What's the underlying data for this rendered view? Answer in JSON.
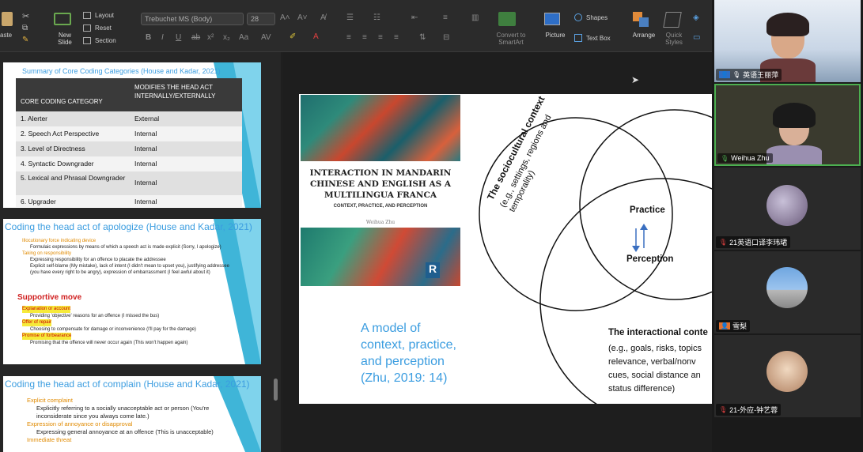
{
  "ribbon": {
    "paste": "aste",
    "layout": "Layout",
    "reset": "Reset",
    "section": "Section",
    "new_slide": "New\nSlide",
    "font_name": "Trebuchet MS (Body)",
    "font_size": "28",
    "convert": "Convert to\nSmartArt",
    "picture": "Picture",
    "shapes": "Shapes",
    "text_box": "Text Box",
    "arrange": "Arrange",
    "quick_styles": "Quick\nStyles"
  },
  "thumb1": {
    "title": "Summary of Core Coding Categories (House and Kadar, 2021)",
    "col1": "CORE CODING CATEGORY",
    "col2": "MODIFIES THE HEAD ACT INTERNALLY/EXTERNALLY",
    "rows": [
      {
        "cat": "1. Alerter",
        "mod": "External"
      },
      {
        "cat": "2. Speech Act Perspective",
        "mod": "Internal"
      },
      {
        "cat": "3. Level of Directness",
        "mod": "Internal"
      },
      {
        "cat": "4. Syntactic Downgrader",
        "mod": "Internal"
      },
      {
        "cat": "5. Lexical and Phrasal Downgrader",
        "mod": "Internal"
      },
      {
        "cat": "6. Upgrader",
        "mod": "Internal"
      }
    ]
  },
  "thumb2": {
    "title": "Coding the head act of apologize (House and Kadar, 2021)",
    "items": [
      "Illocutionary force indicating device",
      "Formulaic expressions by means of which a speech act is made explicit (Sorry, I apologize)",
      "Taking on responsibility",
      "Expressing responsibility for an offence to placate the addressee",
      "Explicit self-blame (My mistake), lack of intent (I didn't mean to upset you), justifying addressee (you have every right to be angry), expression of embarrassment (I feel awful about it)"
    ],
    "supportive": "Supportive move",
    "items2": [
      "Explanation or account",
      "Providing 'objective' reasons for an offence (I missed the bus)",
      "Offer of repair",
      "Choosing to compensate for damage or inconvenience (I'll pay for the damage)",
      "Promise of forbearance",
      "Promising that the offence will never occur again (This won't happen again)"
    ]
  },
  "thumb3": {
    "title": "Coding the head act of complain (House and Kadar, 2021)",
    "items": [
      "Explicit complaint",
      "Explicitly referring to a socially unacceptable act or person (You're inconsiderate since you always come late.)",
      "Expression of annoyance or disapproval",
      "Expressing general annoyance at an offence (This is unacceptable)",
      "Immediate threat"
    ]
  },
  "main_slide": {
    "book_title": "INTERACTION IN MANDARIN CHINESE AND ENGLISH AS A MULTILINGUA FRANCA",
    "book_subtitle": "CONTEXT, PRACTICE, AND PERCEPTION",
    "book_author": "Weihua Zhu",
    "publisher_mark": "R",
    "caption": "A model of context, practice, and perception (Zhu, 2019: 14)",
    "socio_title": "The sociocultural context",
    "socio_detail": "(e.g., settings, regions and temporality)",
    "practice": "Practice",
    "perception": "Perception",
    "interactional_title": "The interactional conte",
    "interactional_detail": "(e.g., goals, risks, topics relevance, verbal/nonv cues, social distance an status difference)"
  },
  "participants": [
    {
      "name": "英语王丽萍"
    },
    {
      "name": "Weihua Zhu"
    },
    {
      "name": "21英语口译李玮珺"
    },
    {
      "name": "雪梨"
    },
    {
      "name": "21-外应-钟艺蓉"
    }
  ],
  "colors": {
    "accent_blue": "#2e6ec6",
    "active_green": "#4caf50",
    "thumb_title_blue": "#3b9de0",
    "ribbon_bg": "#2b2b2b"
  }
}
